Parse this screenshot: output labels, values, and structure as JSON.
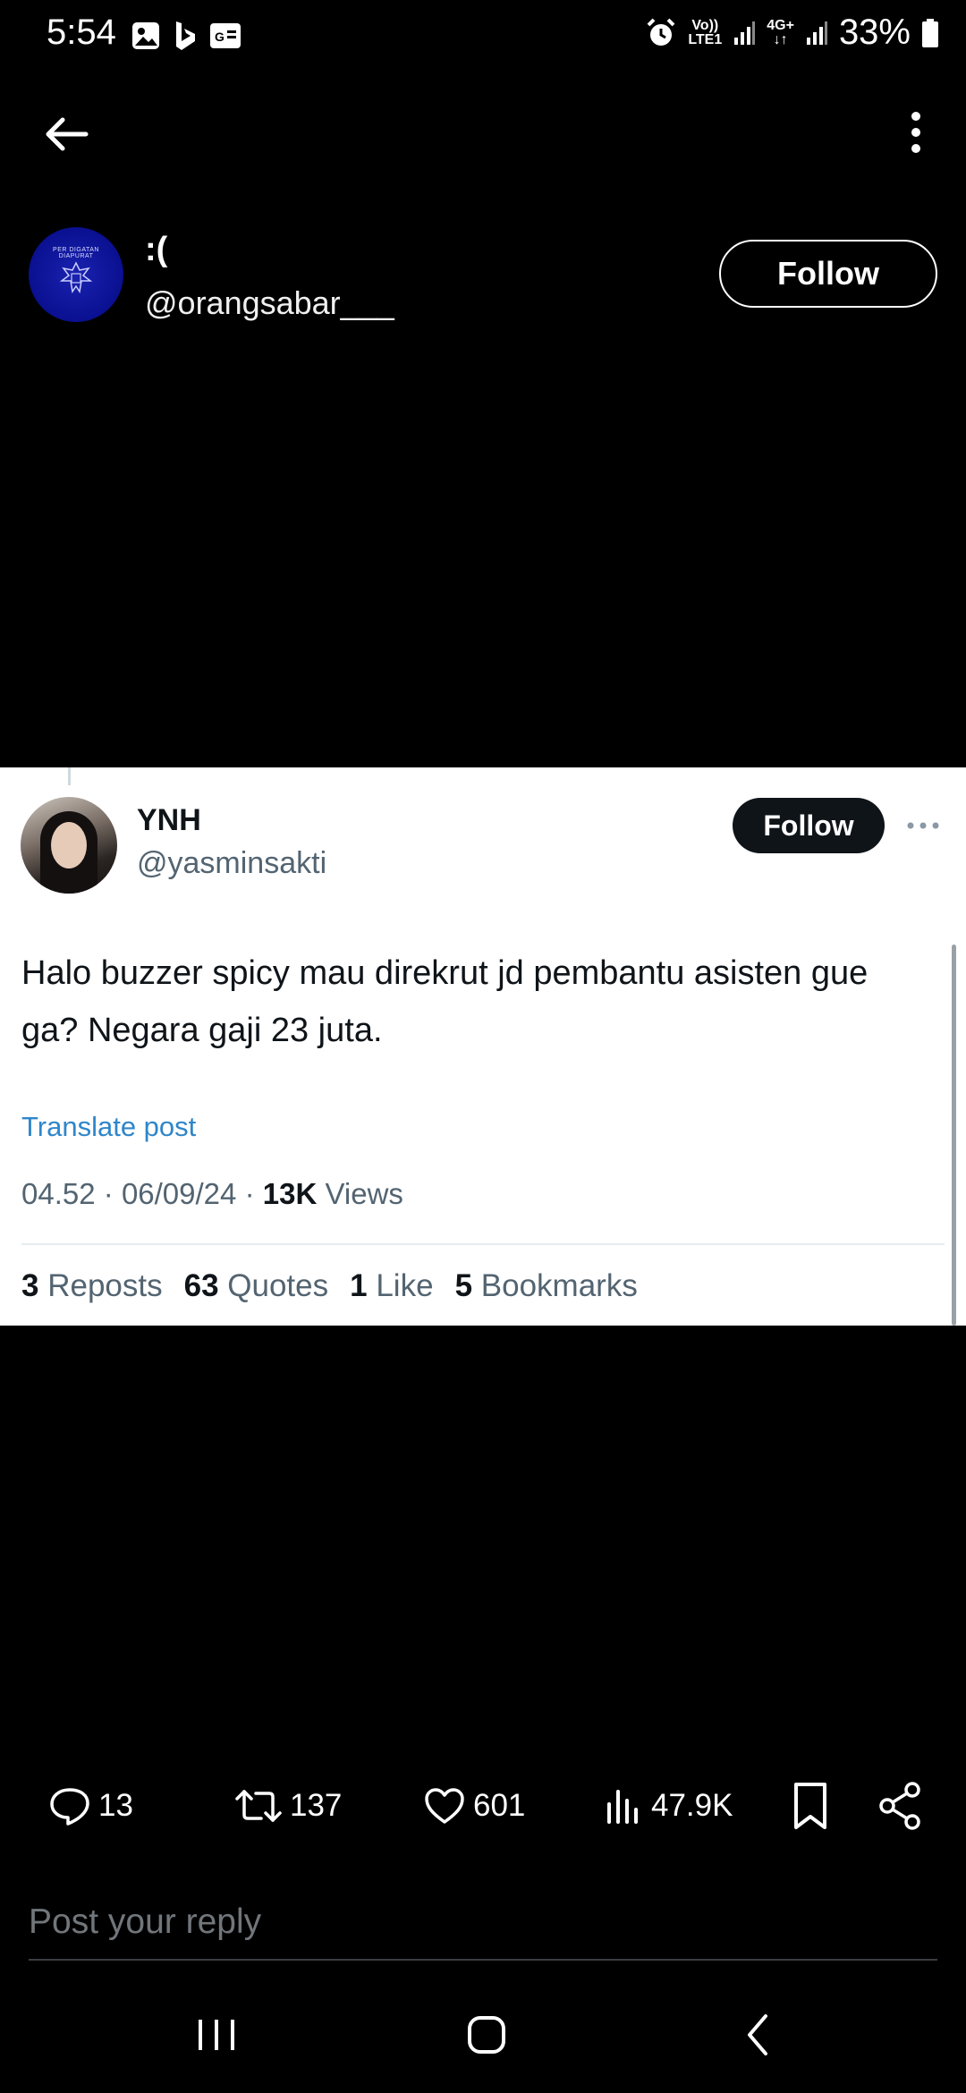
{
  "status_bar": {
    "time": "5:54",
    "battery": "33%",
    "volte": "Vo))",
    "lte": "LTE1",
    "net": "4G+"
  },
  "header": {
    "display_name": ":(",
    "handle": "@orangsabar___",
    "follow_label": "Follow",
    "avatar_text": "PER DIGATAN DIAPURAT"
  },
  "post": {
    "display_name": "YNH",
    "handle": "@yasminsakti",
    "follow_label": "Follow",
    "text": "Halo buzzer spicy mau direkrut jd pembantu asisten gue ga? Negara gaji 23 juta.",
    "translate": "Translate post",
    "time": "04.52",
    "date": "06/09/24",
    "views_count": "13K",
    "views_label": "Views",
    "sep": "·",
    "stats": [
      {
        "count": "3",
        "label": "Reposts"
      },
      {
        "count": "63",
        "label": "Quotes"
      },
      {
        "count": "1",
        "label": "Like"
      },
      {
        "count": "5",
        "label": "Bookmarks"
      }
    ]
  },
  "actions": {
    "replies": "13",
    "reposts": "137",
    "likes": "601",
    "views": "47.9K"
  },
  "reply": {
    "placeholder": "Post your reply"
  },
  "colors": {
    "background": "#000000",
    "card": "#ffffff",
    "link": "#2f86c9",
    "muted": "#536471"
  }
}
